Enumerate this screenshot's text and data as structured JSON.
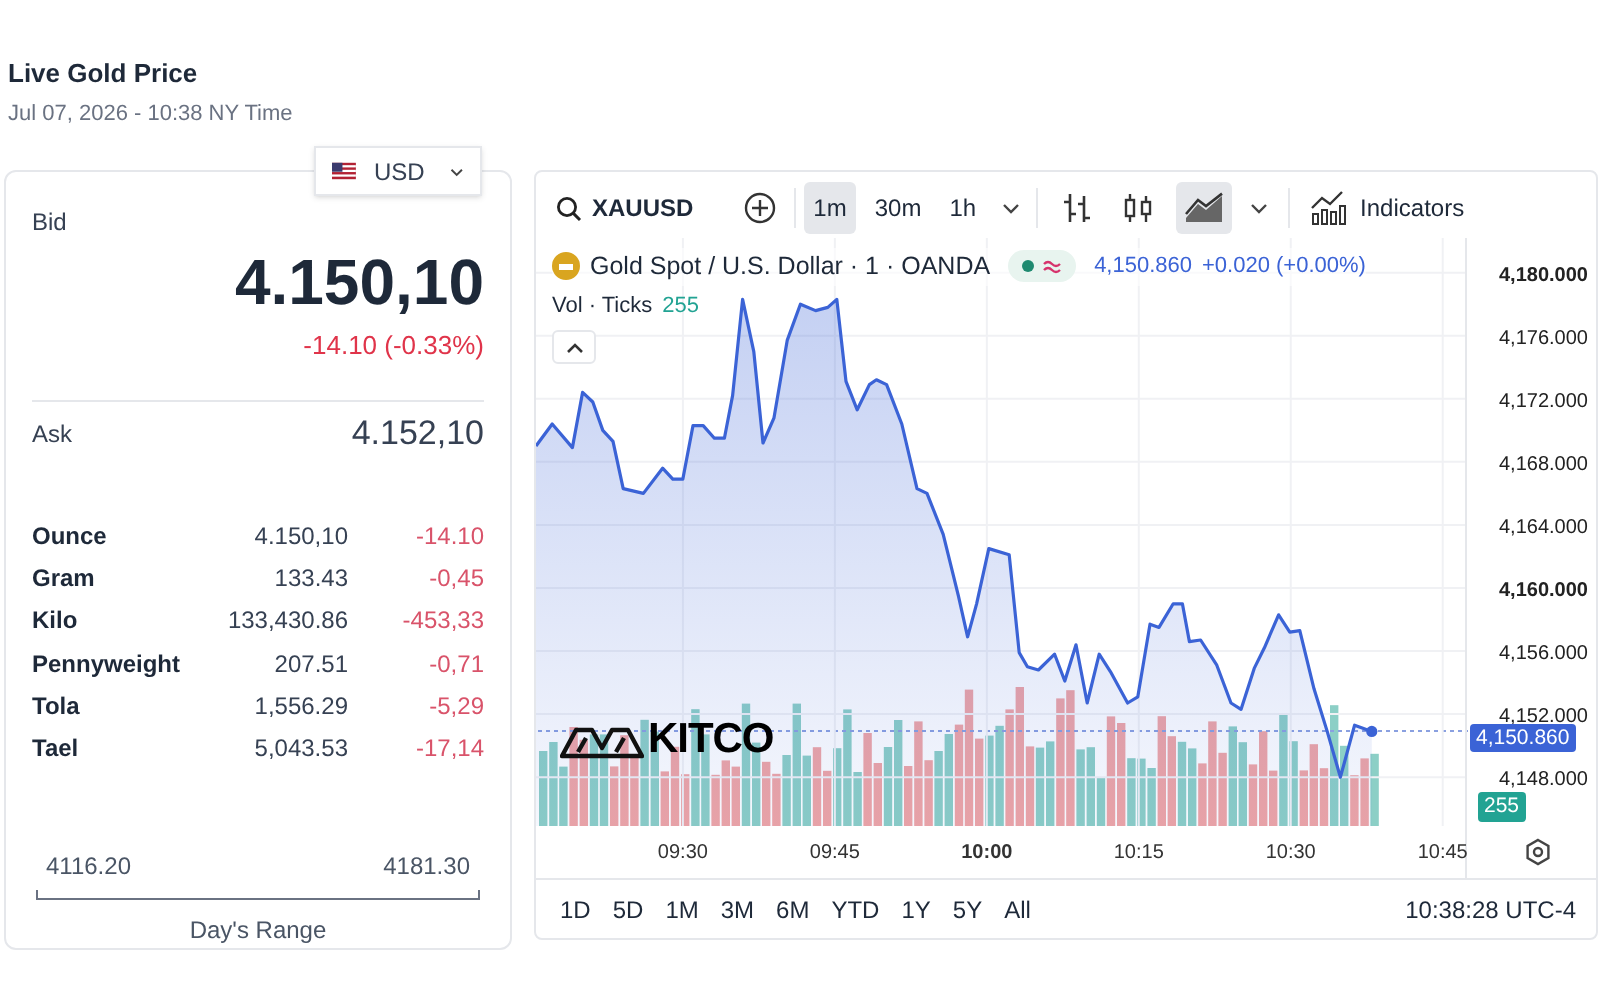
{
  "header": {
    "title": "Live Gold Price",
    "timestamp": "Jul 07, 2026 - 10:38 NY Time"
  },
  "quote": {
    "currency": "USD",
    "bid_label": "Bid",
    "bid": "4.150,10",
    "change": "-14.10 (-0.33%)",
    "ask_label": "Ask",
    "ask": "4.152,10",
    "units": [
      {
        "unit": "Ounce",
        "price": "4.150,10",
        "change": "-14.10"
      },
      {
        "unit": "Gram",
        "price": "133.43",
        "change": "-0,45"
      },
      {
        "unit": "Kilo",
        "price": "133,430.86",
        "change": "-453,33"
      },
      {
        "unit": "Pennyweight",
        "price": "207.51",
        "change": "-0,71"
      },
      {
        "unit": "Tola",
        "price": "1,556.29",
        "change": "-5,29"
      },
      {
        "unit": "Tael",
        "price": "5,043.53",
        "change": "-17,14"
      }
    ],
    "range": {
      "low": "4116.20",
      "high": "4181.30",
      "label": "Day's Range"
    }
  },
  "chart": {
    "symbol": "XAUUSD",
    "intervals": [
      {
        "label": "1m",
        "selected": true
      },
      {
        "label": "30m",
        "selected": false
      },
      {
        "label": "1h",
        "selected": false
      }
    ],
    "chart_types": [
      {
        "kind": "bars",
        "selected": false
      },
      {
        "kind": "candles",
        "selected": false
      },
      {
        "kind": "area",
        "selected": true
      }
    ],
    "indicators": "Indicators",
    "legend": {
      "title": "Gold Spot / U.S. Dollar · 1 · OANDA",
      "last": "4,150.860",
      "change": "+0.020 (+0.00%)",
      "volume_label": "Vol · Ticks",
      "volume": "255"
    },
    "logo": "KITCO",
    "last_price_badge": "4,150.860",
    "volume_badge": "255",
    "chart_data": {
      "type": "area",
      "x": [
        555.5,
        557.1,
        559.1,
        560.1,
        561.1,
        562.1,
        563.1,
        564.1,
        566.1,
        568.0,
        569.0,
        570,
        571,
        572,
        573.1,
        574.1,
        574.9,
        575.9,
        577,
        577.9,
        579,
        580.3,
        581.6,
        583.1,
        584.3,
        585.2,
        586.1,
        587.2,
        588.4,
        589.1,
        590.1,
        591.6,
        593.1,
        594.1,
        595.7,
        597.2,
        598.1,
        599,
        600.2,
        602.2,
        603.2,
        604.0,
        605.1,
        606.7,
        607.7,
        608.8,
        609.9,
        611.1,
        612.2,
        613.9,
        614.9,
        616.1,
        617,
        618.4,
        619.3,
        620,
        621.1,
        622.7,
        624.1,
        625.1,
        626.4,
        627.4,
        628.8,
        629.9,
        630.9,
        632.3,
        633.6,
        634.9,
        636.3,
        638
      ],
      "grid": true,
      "series": [
        {
          "color": "#3b63d6",
          "values": [
            4169.0,
            4170.4,
            4168.9,
            4172.4,
            4171.8,
            4170.0,
            4169.3,
            4166.3,
            4166.0,
            4167.6,
            4166.9,
            4166.9,
            4170.3,
            4170.3,
            4169.5,
            4169.5,
            4172.2,
            4178.3,
            4175.0,
            4169.2,
            4170.8,
            4175.7,
            4178.0,
            4177.6,
            4177.8,
            4178.3,
            4173.1,
            4171.3,
            4172.9,
            4173.2,
            4172.9,
            4170.4,
            4166.3,
            4166.0,
            4163.4,
            4159.5,
            4156.9,
            4159.0,
            4162.5,
            4162.1,
            4155.9,
            4155.0,
            4154.8,
            4155.8,
            4154.1,
            4156.4,
            4152.7,
            4155.8,
            4154.7,
            4152.7,
            4153.1,
            4157.7,
            4157.5,
            4159.0,
            4159.0,
            4156.6,
            4156.7,
            4155.1,
            4152.7,
            4152.3,
            4154.9,
            4156.2,
            4158.3,
            4157.2,
            4157.3,
            4153.6,
            4150.9,
            4148.0,
            4151.3,
            4150.9
          ]
        }
      ],
      "xlim": [
        555.5,
        647.3
      ],
      "ylim": [
        4144.9,
        4182.2
      ],
      "xticks": [
        {
          "value": 570,
          "label": "09:30"
        },
        {
          "value": 585,
          "label": "09:45"
        },
        {
          "value": 600,
          "label": "10:00"
        },
        {
          "value": 615,
          "label": "10:15"
        },
        {
          "value": 630,
          "label": "10:30"
        },
        {
          "value": 645,
          "label": "10:45"
        }
      ],
      "yticks": [
        {
          "value": 4148,
          "label": "4,148.000"
        },
        {
          "value": 4152,
          "label": "4,152.000"
        },
        {
          "value": 4156,
          "label": "4,156.000"
        },
        {
          "value": 4160,
          "label": "4,160.000"
        },
        {
          "value": 4164,
          "label": "4,164.000"
        },
        {
          "value": 4168,
          "label": "4,168.000"
        },
        {
          "value": 4172,
          "label": "4,172.000"
        },
        {
          "value": 4176,
          "label": "4,176.000"
        },
        {
          "value": 4180,
          "label": "4,180.000"
        }
      ]
    },
    "ranges": [
      "1D",
      "5D",
      "1M",
      "3M",
      "6M",
      "YTD",
      "1Y",
      "5Y",
      "All"
    ],
    "clock": "10:38:28 UTC-4"
  }
}
